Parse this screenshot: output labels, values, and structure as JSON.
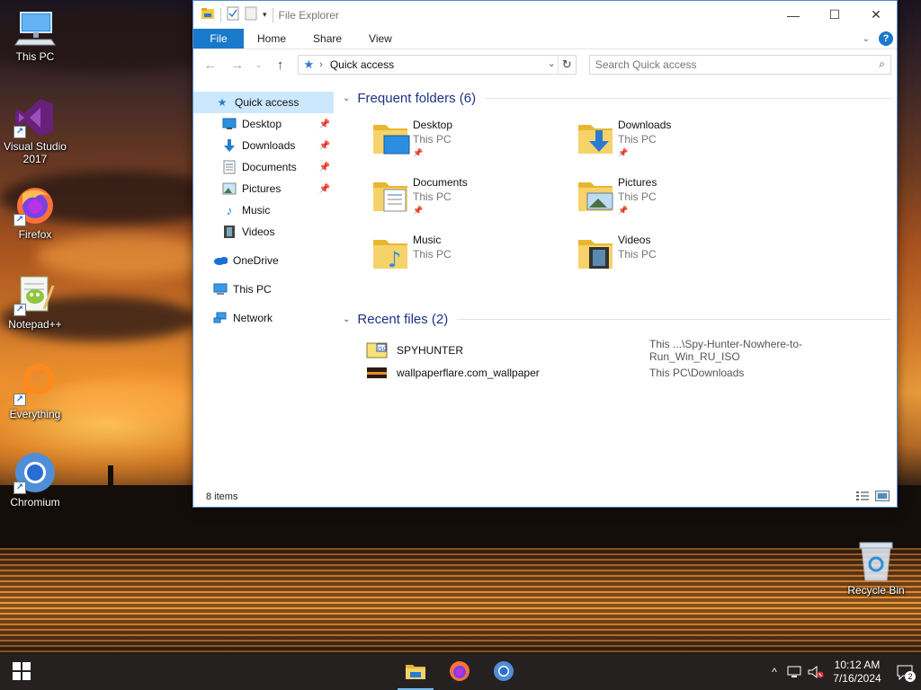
{
  "desktop": {
    "icons": [
      {
        "label": "This PC"
      },
      {
        "label": "Visual Studio 2017"
      },
      {
        "label": "Firefox"
      },
      {
        "label": "Notepad++"
      },
      {
        "label": "Everything"
      },
      {
        "label": "Chromium"
      },
      {
        "label": "Recycle Bin"
      }
    ]
  },
  "explorer": {
    "title": "File Explorer",
    "tabs": [
      "File",
      "Home",
      "Share",
      "View"
    ],
    "address": {
      "location": "Quick access"
    },
    "search": {
      "placeholder": "Search Quick access"
    },
    "nav": {
      "quick_access": "Quick access",
      "items": [
        "Desktop",
        "Downloads",
        "Documents",
        "Pictures",
        "Music",
        "Videos"
      ],
      "onedrive": "OneDrive",
      "thispc": "This PC",
      "network": "Network"
    },
    "frequent": {
      "header": "Frequent folders (6)",
      "folders": [
        {
          "name": "Desktop",
          "location": "This PC"
        },
        {
          "name": "Downloads",
          "location": "This PC"
        },
        {
          "name": "Documents",
          "location": "This PC"
        },
        {
          "name": "Pictures",
          "location": "This PC"
        },
        {
          "name": "Music",
          "location": "This PC"
        },
        {
          "name": "Videos",
          "location": "This PC"
        }
      ]
    },
    "recent": {
      "header": "Recent files (2)",
      "files": [
        {
          "name": "SPYHUNTER",
          "path": "This ...\\Spy-Hunter-Nowhere-to-Run_Win_RU_ISO"
        },
        {
          "name": "wallpaperflare.com_wallpaper",
          "path": "This PC\\Downloads"
        }
      ]
    },
    "status": {
      "count": "8 items"
    }
  },
  "taskbar": {
    "time": "10:12 AM",
    "date": "7/16/2024",
    "notification_count": "2"
  },
  "colors": {
    "accent": "#1979ca",
    "selection": "#cce8ff",
    "group_header": "#1e3287"
  }
}
